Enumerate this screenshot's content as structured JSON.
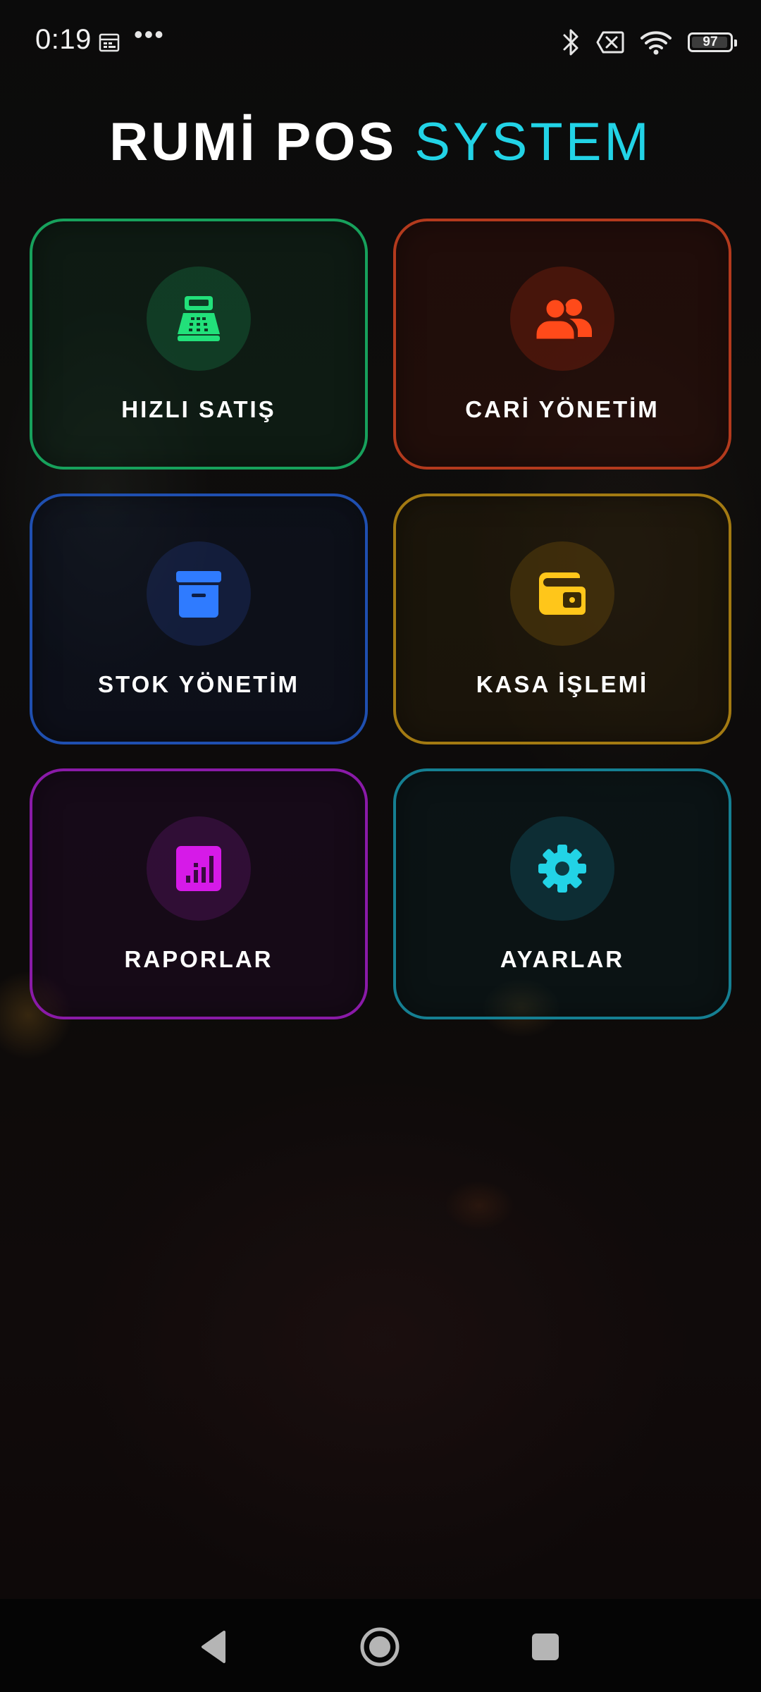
{
  "status_bar": {
    "time": "0:19",
    "battery": "97",
    "battery_fraction": 0.97,
    "icons": [
      "calendar-icon",
      "more-dots-icon",
      "bluetooth-icon",
      "no-sim-icon",
      "wifi-icon",
      "battery-icon"
    ],
    "dots": "•••"
  },
  "header": {
    "title_bold": "RUMİ POS",
    "title_light": "SYSTEM",
    "title_light_color": "#22d3e6"
  },
  "menu": [
    {
      "label": "HIZLI SATIŞ",
      "icon": "cash-register-icon",
      "accent": "#17a15c",
      "icon_color": "#22e07a"
    },
    {
      "label": "CARİ YÖNETİM",
      "icon": "users-icon",
      "accent": "#b33a1d",
      "icon_color": "#ff4a1a"
    },
    {
      "label": "STOK YÖNETİM",
      "icon": "archive-box-icon",
      "accent": "#1f4fb0",
      "icon_color": "#2f7bff"
    },
    {
      "label": "KASA İŞLEMİ",
      "icon": "wallet-icon",
      "accent": "#a37a12",
      "icon_color": "#ffc61a"
    },
    {
      "label": "RAPORLAR",
      "icon": "bar-chart-icon",
      "accent": "#8a1aa8",
      "icon_color": "#d61ae8"
    },
    {
      "label": "AYARLAR",
      "icon": "gear-icon",
      "accent": "#157f92",
      "icon_color": "#22d3e6"
    }
  ],
  "nav_bar": {
    "icons": [
      "back-icon",
      "home-icon",
      "recents-icon"
    ]
  }
}
